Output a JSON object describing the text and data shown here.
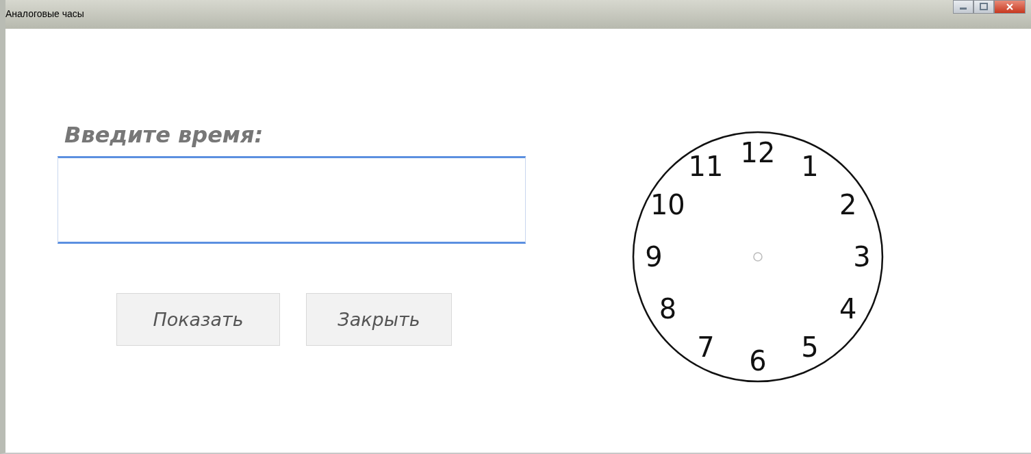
{
  "window": {
    "title": "Аналоговые часы"
  },
  "form": {
    "label": "Введите время:",
    "buttons": [
      {
        "label": "Показать"
      },
      {
        "label": "Закрыть"
      }
    ]
  },
  "clock": {
    "numerals": [
      "12",
      "1",
      "2",
      "3",
      "4",
      "5",
      "6",
      "7",
      "8",
      "9",
      "10",
      "11"
    ]
  }
}
